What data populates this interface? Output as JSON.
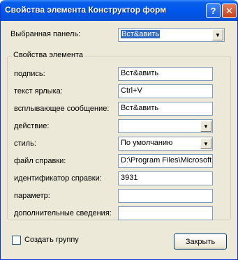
{
  "window": {
    "title": "Свойства элемента Конструктор форм",
    "help_glyph": "?",
    "close_glyph": "✕"
  },
  "panel": {
    "label": "Выбранная панель:",
    "value": "Вст&авить"
  },
  "group": {
    "title": "Свойства элемента",
    "rows": {
      "caption": {
        "label": "подпись:",
        "value": "Вст&авить"
      },
      "shortcut": {
        "label": "текст ярлыка:",
        "value": "Ctrl+V"
      },
      "tooltip": {
        "label": "всплывающее сообщение:",
        "value": "Вст&авить"
      },
      "action": {
        "label": "действие:",
        "value": ""
      },
      "style": {
        "label": "стиль:",
        "value": "По умолчанию"
      },
      "help_file": {
        "label": "файл справки:",
        "value": "D:\\Program Files\\Microsoft O"
      },
      "help_id": {
        "label": "идентификатор справки:",
        "value": "3931"
      },
      "parameter": {
        "label": "параметр:",
        "value": ""
      },
      "extra": {
        "label": "дополнительные сведения:",
        "value": ""
      }
    }
  },
  "create_group": {
    "label": "Создать группу",
    "checked": false
  },
  "close_button": {
    "label": "Закрыть"
  }
}
